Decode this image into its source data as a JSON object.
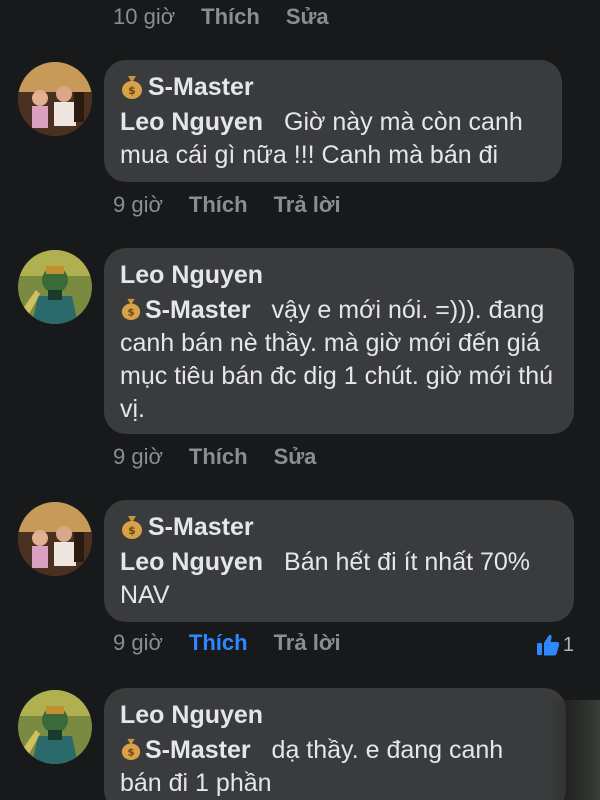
{
  "top_actions": {
    "time": "10 giờ",
    "like": "Thích",
    "edit": "Sửa"
  },
  "comments": [
    {
      "author": "S-Master",
      "mention": "Leo Nguyen",
      "text": "Giờ này mà còn canh mua cái gì nữa !!! Canh mà bán đi",
      "time": "9 giờ",
      "like": "Thích",
      "reply": "Trả lời"
    },
    {
      "author": "Leo Nguyen",
      "mention": "S-Master",
      "text": "vậy e mới nói. =))). đang canh bán nè thầy. mà giờ mới đến giá mục tiêu bán đc dig 1 chút. giờ mới thú vị.",
      "time": "9 giờ",
      "like": "Thích",
      "edit": "Sửa"
    },
    {
      "author": "S-Master",
      "mention": "Leo Nguyen",
      "text": "Bán hết đi ít nhất 70% NAV",
      "time": "9 giờ",
      "like": "Thích",
      "reply": "Trả lời",
      "reaction_count": "1"
    },
    {
      "author": "Leo Nguyen",
      "mention": "S-Master",
      "text": "dạ thầy. e đang canh bán đi 1 phần"
    }
  ],
  "colors": {
    "background": "#18191a",
    "bubble": "#3a3b3c",
    "muted": "#8a8d91",
    "link_active": "#2d88ff",
    "like_blue": "#2d88ff"
  }
}
